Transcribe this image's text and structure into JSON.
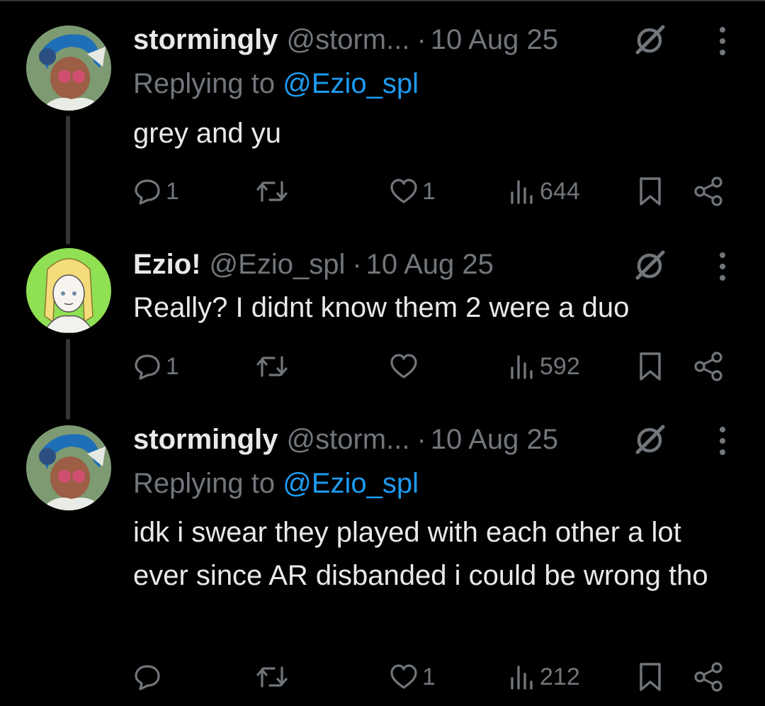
{
  "posts": [
    {
      "name": "stormingly",
      "handle": "@storm...",
      "dot": "·",
      "date": "10 Aug 25",
      "replying_prefix": "Replying to ",
      "replying_handle": "@Ezio_spl",
      "text": "grey and yu",
      "replies": "1",
      "reposts": "",
      "likes": "1",
      "views": "644"
    },
    {
      "name": "Ezio!",
      "handle": "@Ezio_spl",
      "dot": "·",
      "date": "10 Aug 25",
      "text": "Really? I didnt know them 2 were a duo",
      "replies": "1",
      "reposts": "",
      "likes": "",
      "views": "592"
    },
    {
      "name": "stormingly",
      "handle": "@storm...",
      "dot": "·",
      "date": "10 Aug 25",
      "replying_prefix": "Replying to ",
      "replying_handle": "@Ezio_spl",
      "text": "idk i swear they played with each other a lot ever since AR disbanded i could be wrong tho",
      "replies": "",
      "reposts": "",
      "likes": "1",
      "views": "212"
    }
  ],
  "icons": {
    "reply": "reply-icon",
    "repost": "repost-icon",
    "like": "like-icon",
    "views": "views-icon",
    "bookmark": "bookmark-icon",
    "share": "share-icon",
    "grok": "grok-icon",
    "more": "more-icon"
  },
  "colors": {
    "background": "#000000",
    "text": "#e7e9ea",
    "muted": "#71767b",
    "link": "#1d9bf0",
    "thread_line": "#333639"
  }
}
